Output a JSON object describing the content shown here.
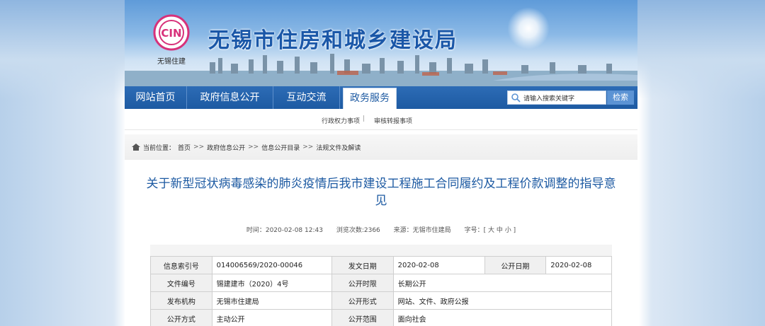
{
  "site": {
    "title": "无锡市住房和城乡建设局",
    "logo_text": "CIN",
    "logo_sub": "无锡住建"
  },
  "nav": {
    "items": [
      {
        "label": "网站首页"
      },
      {
        "label": "政府信息公开"
      },
      {
        "label": "互动交流"
      },
      {
        "label": "政务服务"
      }
    ],
    "active_index": 3
  },
  "search": {
    "placeholder": "请输入搜索关键字",
    "button": "检索"
  },
  "subnav": {
    "items": [
      "行政权力事项",
      "审核转报事项"
    ],
    "separator": "|"
  },
  "breadcrumb": {
    "prefix": "当前位置：",
    "items": [
      "首页",
      "政府信息公开",
      "信息公开目录",
      "法规文件及解读"
    ],
    "separator": ">>"
  },
  "article": {
    "title": "关于新型冠状病毒感染的肺炎疫情后我市建设工程施工合同履约及工程价款调整的指导意见",
    "time_label": "时间：",
    "time_value": "2020-02-08 12:43",
    "views_label": "浏览次数:",
    "views_value": "2366",
    "source_label": "来源：",
    "source_value": "无锡市住建局",
    "fontsize_label": "字号：",
    "fontsize_open": "[",
    "fontsize_large": "大",
    "fontsize_medium": "中",
    "fontsize_small": "小",
    "fontsize_close": "]"
  },
  "info_table": {
    "rows": [
      [
        "信息索引号",
        "014006569/2020-00046",
        "发文日期",
        "2020-02-08",
        "公开日期",
        "2020-02-08"
      ],
      [
        "文件编号",
        "锡建建市（2020）4号",
        "公开时限",
        "长期公开",
        "",
        ""
      ],
      [
        "发布机构",
        "无锡市住建局",
        "公开形式",
        "网站、文件、政府公报",
        "",
        ""
      ],
      [
        "公开方式",
        "主动公开",
        "公开范围",
        "面向社会",
        "",
        ""
      ]
    ]
  },
  "colors": {
    "brand_blue": "#1d5aa2",
    "title_blue": "#1d5aa2"
  }
}
